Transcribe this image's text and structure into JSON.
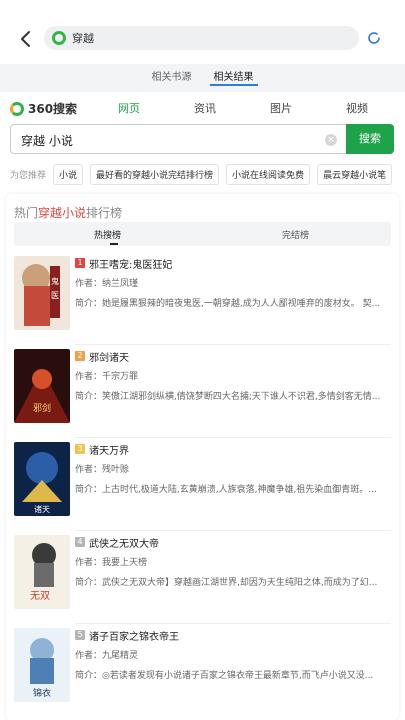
{
  "topbar": {
    "query": "穿越"
  },
  "tabs": [
    {
      "label": "相关书源"
    },
    {
      "label": "相关结果"
    }
  ],
  "engine": {
    "logo_text": "360搜索",
    "nav": [
      "网页",
      "资讯",
      "图片",
      "视频"
    ]
  },
  "search": {
    "value": "穿越 小说",
    "button": "搜索"
  },
  "reco": {
    "label": "为您推荐",
    "chips": [
      "小说",
      "最好看的穿越小说完结排行榜",
      "小说在线阅读免费",
      "晨云穿越小说笔"
    ]
  },
  "ranking": {
    "title_prefix": "热门",
    "title_highlight": "穿越小说",
    "title_suffix": "排行榜",
    "tabs": [
      "热搜榜",
      "完结榜"
    ]
  },
  "books": [
    {
      "rank": "1",
      "rank_color": "#e2453c",
      "title": "邪王嗜宠:鬼医狂妃",
      "author": "作者：纳兰凤瑾",
      "desc": "简介：她是履黑狠辣的暗夜鬼医,一朝穿越,成为人人鄙视唾弃的废材女。 契..."
    },
    {
      "rank": "2",
      "rank_color": "#f0a04b",
      "title": "邪剑诸天",
      "author": "作者：千宗万罪",
      "desc": "简介：笑傲江湖邪剑纵横,倩饶梦断四大名捕;天下谁人不识君,多情剑客无情..."
    },
    {
      "rank": "3",
      "rank_color": "#f2c14e",
      "title": "诸天万界",
      "author": "作者：残叶赊",
      "desc": "简介：上古时代,极道大陆,玄黄崩溃,人族衰落,神魔争雄,祖先染血御青斑。..."
    },
    {
      "rank": "4",
      "rank_color": "#b5b5b5",
      "title": "武侠之无双大帝",
      "author": "作者：我要上天榜",
      "desc": "简介：武侠之无双大帝】穿越画江湖世界,却因为天生纯阳之体,而成为了幻..."
    },
    {
      "rank": "5",
      "rank_color": "#b5b5b5",
      "title": "诸子百家之锦衣帝王",
      "author": "作者：九尾精灵",
      "desc": "简介：◎若读者发现有小说诸子百家之锦衣帝王最新章节,而飞卢小说又没..."
    }
  ],
  "colors": {
    "accent": "#1fa34a",
    "highlight": "#e2453c",
    "tab_indicator": "#2a7de1"
  }
}
